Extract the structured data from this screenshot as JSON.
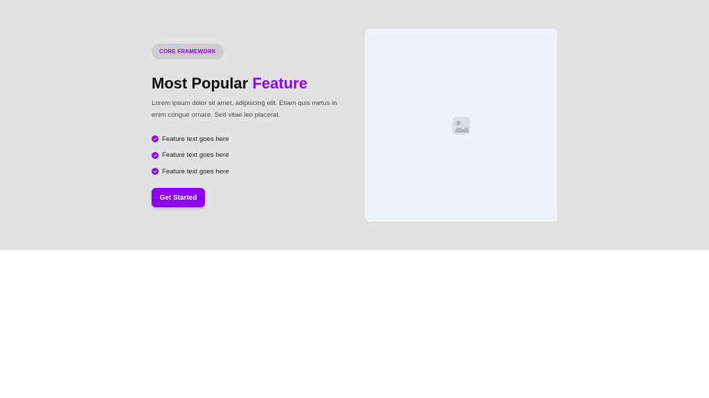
{
  "hero": {
    "badge": "CORE FRAMEWORK",
    "headline_main": "Most Popular ",
    "headline_accent": "Feature",
    "description": "Lorem ipsum dolor sit amet, adipiscing elit. Etiam quis metus in enim congue ornare. Sed vitae leo placerat.",
    "features": [
      {
        "label": "Feature text goes here",
        "icon": "check-circle-icon"
      },
      {
        "label": "Feature text goes here",
        "icon": "check-circle-icon"
      },
      {
        "label": "Feature text goes here",
        "icon": "check-circle-icon"
      }
    ],
    "cta_label": "Get Started",
    "media_icon": "image-placeholder-icon"
  },
  "colors": {
    "accent": "#8d00f2",
    "hero_background": "#e2e2e2",
    "badge_background": "#cdcdcd",
    "media_background": "#f1f2f7",
    "page_background": "#ffffff"
  }
}
